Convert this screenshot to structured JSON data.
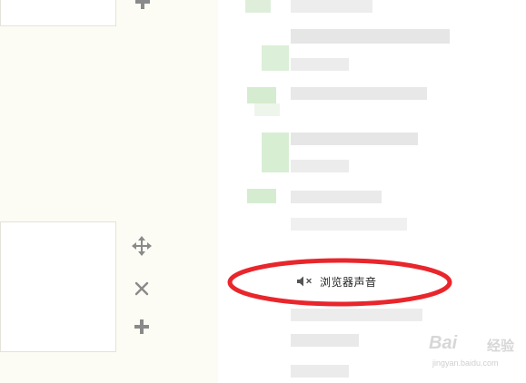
{
  "context_menu": {
    "items": [
      {
        "label": "浏览器声音",
        "icon": "speaker-muted-icon"
      }
    ],
    "highlight_color": "#e8262c"
  },
  "toolbar": {
    "icons": [
      "plus-icon",
      "move-icon",
      "close-icon",
      "plus-icon"
    ]
  },
  "watermark": {
    "brand": "Bai",
    "brand_suffix": "经验",
    "url": "jingyan.baidu.com"
  }
}
